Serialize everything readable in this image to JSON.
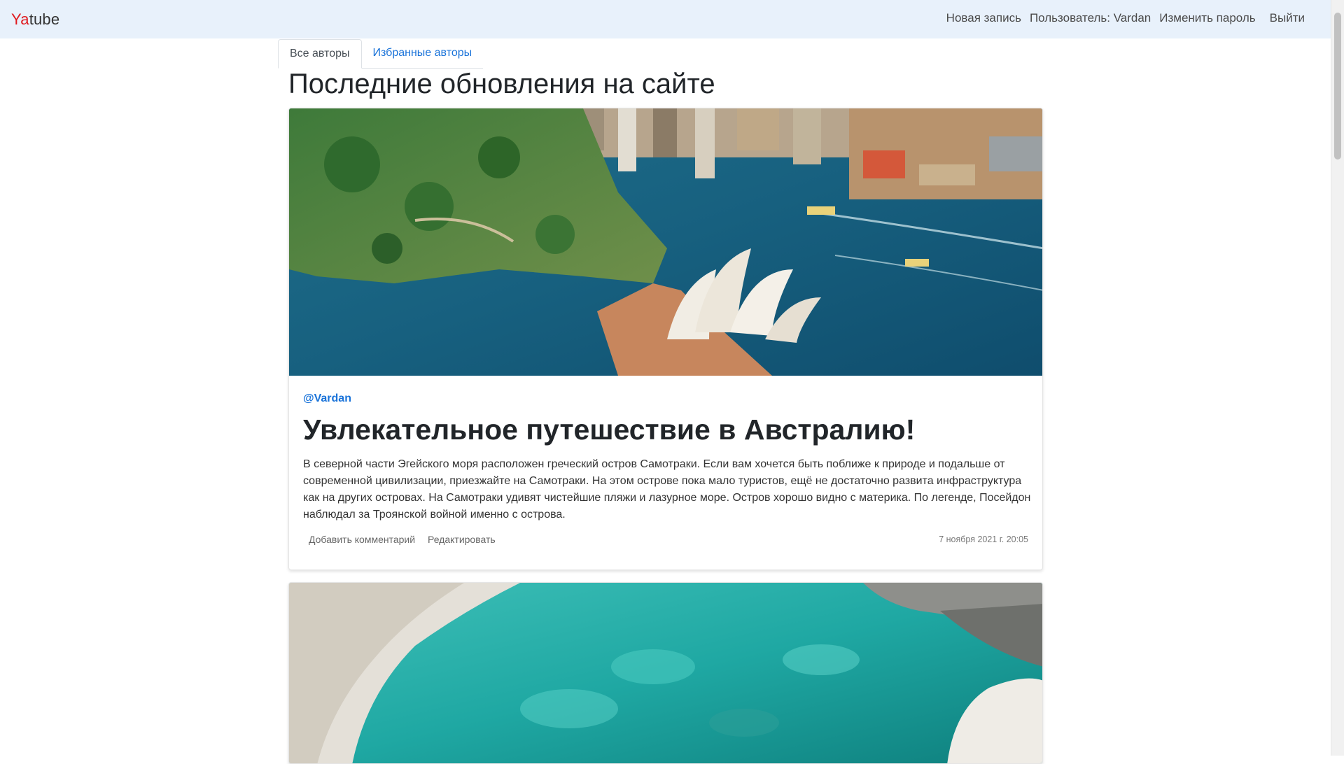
{
  "navbar": {
    "brand_prefix": "Ya",
    "brand_suffix": "tube",
    "links": {
      "new_post": "Новая запись",
      "user": "Пользователь: Vardan",
      "change_password": "Изменить пароль",
      "logout": "Выйти"
    }
  },
  "tabs": [
    {
      "label": "Все авторы",
      "active": true
    },
    {
      "label": "Избранные авторы",
      "active": false
    }
  ],
  "page_title": "Последние обновления на сайте",
  "posts": [
    {
      "image_alt": "Sydney Opera House harbor aerial view",
      "author": "@Vardan",
      "title": "Увлекательное путешествие в Австралию!",
      "text": "В северной части Эгейского моря расположен греческий остров Самотраки. Если вам хочется быть поближе к природе и подальше от современной цивилизации, приезжайте на Самотраки. На этом острове пока мало туристов, ещё не достаточно развита инфраструктура как на других островах. На Самотраки удивят чистейшие пляжи и лазурное море. Остров хорошо видно с материка. По легенде, Посейдон наблюдал за Троянской войной именно с острова.",
      "actions": {
        "comment": "Добавить комментарий",
        "edit": "Редактировать"
      },
      "date": "7 ноября 2021 г. 20:05"
    },
    {
      "image_alt": "Turquoise rocky lagoon"
    }
  ],
  "colors": {
    "navbar_bg": "#e8f1fb",
    "brand_red": "#e0191e",
    "link_blue": "#1a73d9"
  }
}
